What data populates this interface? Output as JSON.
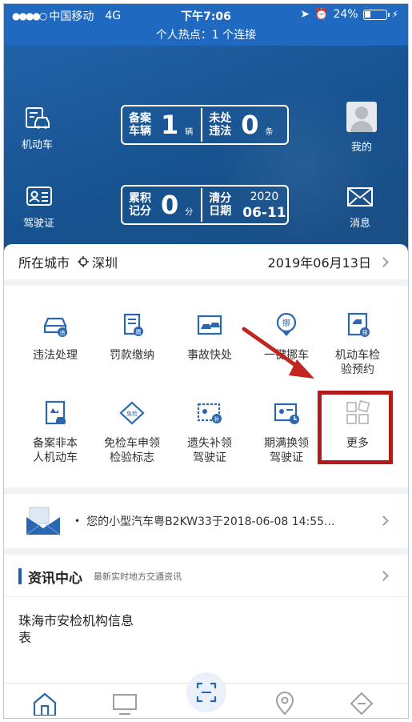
{
  "status_bar": {
    "carrier": "中国移动",
    "network": "4G",
    "time": "下午7:06",
    "battery": "24%",
    "hotspot": "个人热点：1 个连接"
  },
  "hero": {
    "vehicle_btn": "机动车",
    "license_btn": "驾驶证",
    "profile_btn": "我的",
    "message_btn": "消息",
    "vehicle_card": {
      "label_1": "备案",
      "label_2": "车辆",
      "count": "1",
      "unit": "辆",
      "violation_label_1": "未处",
      "violation_label_2": "违法",
      "violation_count": "0",
      "violation_unit": "条"
    },
    "score_card": {
      "label_1": "累积",
      "label_2": "记分",
      "score": "0",
      "unit": "分",
      "clear_label_1": "清分",
      "clear_label_2": "日期",
      "year": "2020",
      "date": "06-11"
    }
  },
  "city_row": {
    "label": "所在城市",
    "city": "深圳",
    "date": "2019年06月13日"
  },
  "services": [
    {
      "line1": "违法处理",
      "line2": "",
      "icon": "car-violation-icon"
    },
    {
      "line1": "罚款缴纳",
      "line2": "",
      "icon": "fine-receipt-icon"
    },
    {
      "line1": "事故快处",
      "line2": "",
      "icon": "accident-icon"
    },
    {
      "line1": "一键挪车",
      "line2": "",
      "icon": "move-car-icon"
    },
    {
      "line1": "机动车检",
      "line2": "验预约",
      "icon": "inspection-appointment-icon"
    },
    {
      "line1": "备案非本",
      "line2": "人机动车",
      "icon": "register-vehicle-icon"
    },
    {
      "line1": "免检车申领",
      "line2": "检验标志",
      "icon": "exempt-badge-icon"
    },
    {
      "line1": "遗失补领",
      "line2": "驾驶证",
      "icon": "reissue-license-icon"
    },
    {
      "line1": "期满换领",
      "line2": "驾驶证",
      "icon": "renew-license-icon"
    },
    {
      "line1": "更多",
      "line2": "",
      "icon": "more-grid-icon"
    }
  ],
  "notice": {
    "dot": "•",
    "text": "您的小型汽车粤B2KW33于2018-06-08 14:55..."
  },
  "news": {
    "title": "资讯中心",
    "subtitle": "最新实时地方交通资讯",
    "item": "珠海市安检机构信息表"
  },
  "colors": {
    "brand_blue": "#1c5ea5",
    "highlight_red": "#b31a1a",
    "annotation_arrow": "#c0251f"
  }
}
